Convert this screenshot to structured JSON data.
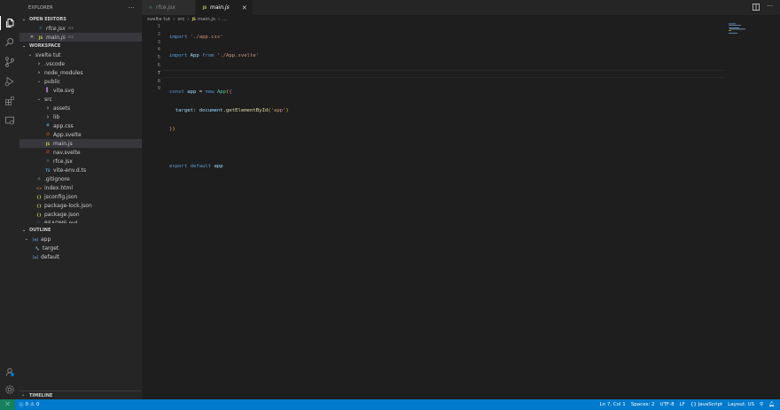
{
  "explorer": {
    "title": "EXPLORER",
    "more": "···",
    "open_editors": {
      "label": "OPEN EDITORS",
      "items": [
        {
          "name": "rfce.jsx",
          "dir": "src",
          "icon": "react-icon",
          "color": "#519aba"
        },
        {
          "name": "main.js",
          "dir": "src",
          "icon": "js-icon",
          "color": "#cbcb41",
          "close": "✕"
        }
      ]
    },
    "workspace": {
      "label": "WORKSPACE",
      "root": "svelte tut",
      "items": [
        {
          "name": ".vscode",
          "type": "folder"
        },
        {
          "name": "node_modules",
          "type": "folder"
        },
        {
          "name": "public",
          "type": "folder-open"
        },
        {
          "name": "vite.svg",
          "type": "file",
          "glyph": "▌",
          "color": "#a074c4"
        },
        {
          "name": "src",
          "type": "folder-open"
        },
        {
          "name": "assets",
          "type": "folder"
        },
        {
          "name": "lib",
          "type": "folder"
        },
        {
          "name": "app.css",
          "type": "file",
          "glyph": "#",
          "color": "#519aba"
        },
        {
          "name": "App.svelte",
          "type": "file",
          "glyph": "⊘",
          "color": "#e44d26"
        },
        {
          "name": "main.js",
          "type": "file",
          "glyph": "JS",
          "color": "#cbcb41"
        },
        {
          "name": "nav.svelte",
          "type": "file",
          "glyph": "⊘",
          "color": "#e44d26"
        },
        {
          "name": "rfce.jsx",
          "type": "file",
          "glyph": "⚛",
          "color": "#519aba"
        },
        {
          "name": "vite-env.d.ts",
          "type": "file",
          "glyph": "TS",
          "color": "#519aba"
        },
        {
          "name": ".gitignore",
          "type": "file",
          "glyph": "◆",
          "color": "#41535b"
        },
        {
          "name": "index.html",
          "type": "file",
          "glyph": "<>",
          "color": "#e37933"
        },
        {
          "name": "jsconfig.json",
          "type": "file",
          "glyph": "{}",
          "color": "#cbcb41"
        },
        {
          "name": "package-lock.json",
          "type": "file",
          "glyph": "{}",
          "color": "#cbcb41"
        },
        {
          "name": "package.json",
          "type": "file",
          "glyph": "{}",
          "color": "#cbcb41"
        },
        {
          "name": "README.md",
          "type": "file",
          "glyph": "ⓘ",
          "color": "#519aba"
        }
      ]
    },
    "outline": {
      "label": "OUTLINE",
      "items": [
        {
          "name": "app",
          "glyph": "[⊕]",
          "level": 0
        },
        {
          "name": "target",
          "glyph": "🔧",
          "level": 1
        },
        {
          "name": "default",
          "glyph": "[⊕]",
          "level": 0
        }
      ]
    },
    "timeline": {
      "label": "TIMELINE"
    }
  },
  "tabs": [
    {
      "label": "rfce.jsx",
      "icon": "⚛",
      "color": "#519aba",
      "active": false
    },
    {
      "label": "main.js",
      "icon": "JS",
      "color": "#cbcb41",
      "active": true,
      "close": "✕"
    }
  ],
  "breadcrumb": [
    "svelte tut",
    "src",
    "main.js",
    "..."
  ],
  "editor": {
    "line_numbers": [
      "1",
      "2",
      "3",
      "4",
      "5",
      "6",
      "7",
      "8",
      "9"
    ]
  },
  "status": {
    "remote": "⤫",
    "errors": "0",
    "warnings": "0",
    "position": "Ln 7, Col 1",
    "spaces": "Spaces: 2",
    "encoding": "UTF-8",
    "eol": "LF",
    "language": "JavaScript",
    "layout": "Layout: US"
  },
  "colors": {
    "accent": "#007acc",
    "sidebar": "#252526",
    "editor": "#1e1e1e",
    "remote": "#16825d"
  }
}
